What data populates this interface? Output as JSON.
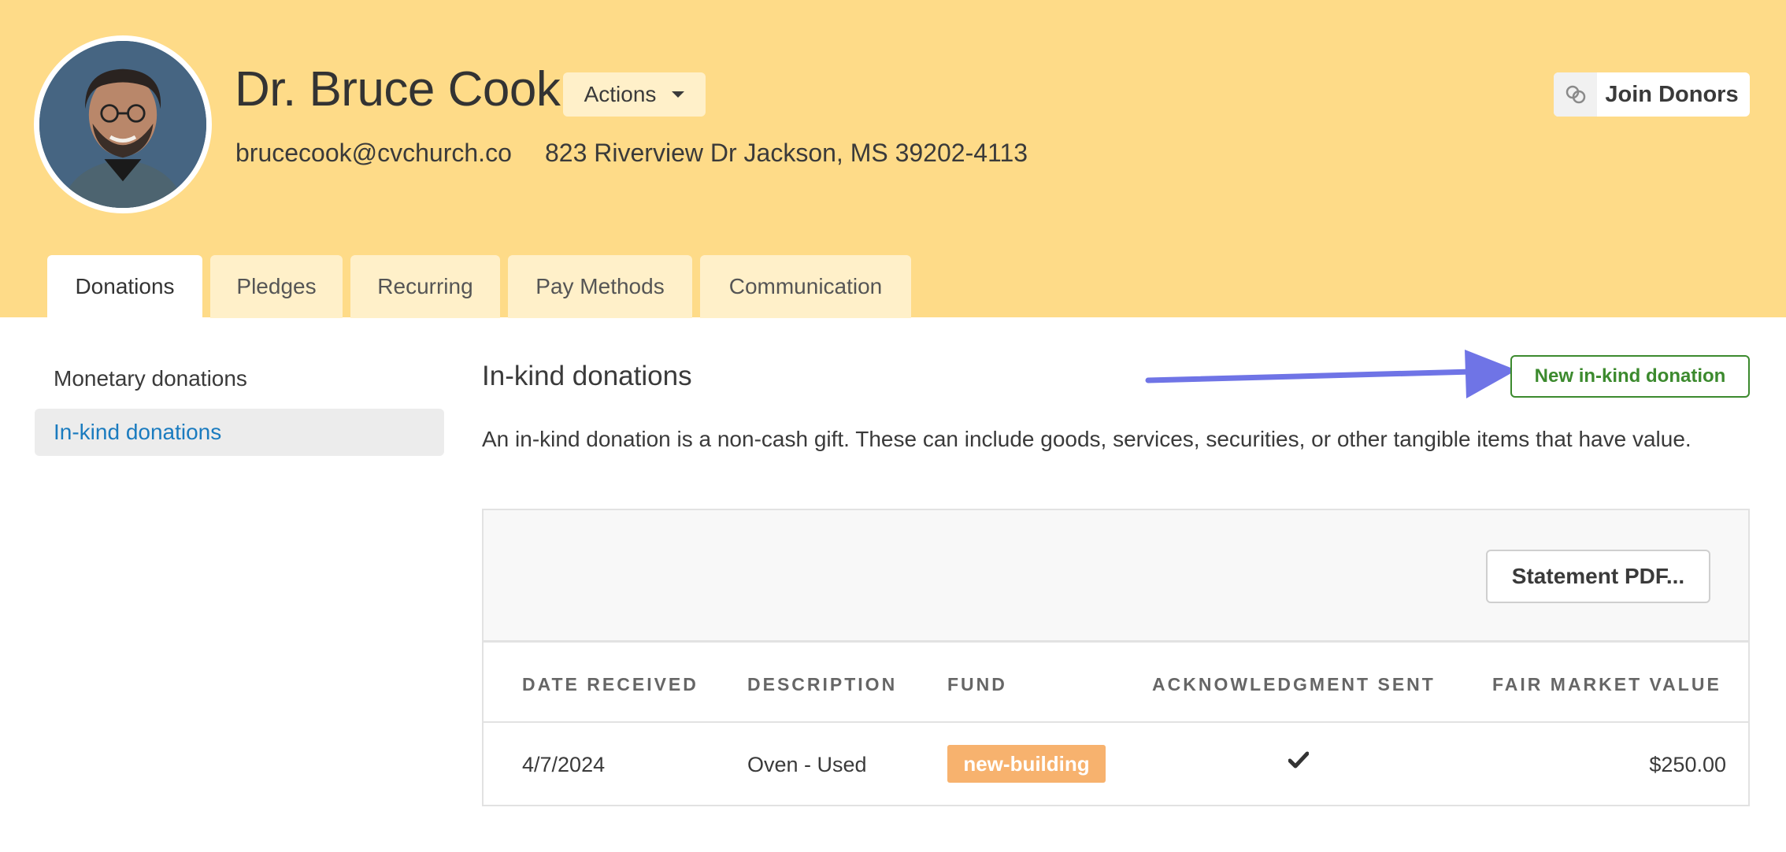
{
  "donor": {
    "name": "Dr. Bruce Cook",
    "email": "brucecook@cvchurch.co",
    "address": "823 Riverview Dr Jackson, MS 39202-4113"
  },
  "header": {
    "actions_label": "Actions",
    "join_label": "Join Donors",
    "background_color": "#fedb88"
  },
  "tabs": [
    {
      "label": "Donations",
      "active": true
    },
    {
      "label": "Pledges",
      "active": false
    },
    {
      "label": "Recurring",
      "active": false
    },
    {
      "label": "Pay Methods",
      "active": false
    },
    {
      "label": "Communication",
      "active": false
    }
  ],
  "sidebar": {
    "items": [
      {
        "label": "Monetary donations",
        "active": false
      },
      {
        "label": "In-kind donations",
        "active": true
      }
    ]
  },
  "main": {
    "title": "In-kind donations",
    "new_button_label": "New in-kind donation",
    "description": "An in-kind donation is a non-cash gift. These can include goods, services, securities, or other tangible items that have value.",
    "statement_button_label": "Statement PDF...",
    "columns": [
      "DATE RECEIVED",
      "DESCRIPTION",
      "FUND",
      "ACKNOWLEDGMENT SENT",
      "FAIR MARKET VALUE"
    ],
    "rows": [
      {
        "date": "4/7/2024",
        "description": "Oven - Used",
        "fund": "new-building",
        "acknowledgment_sent": true,
        "value": "$250.00"
      }
    ]
  },
  "colors": {
    "accent_green": "#3c8a2e",
    "link_blue": "#1a7bbf",
    "fund_badge": "#f7b26e",
    "annotation_arrow": "#6f74e6"
  }
}
